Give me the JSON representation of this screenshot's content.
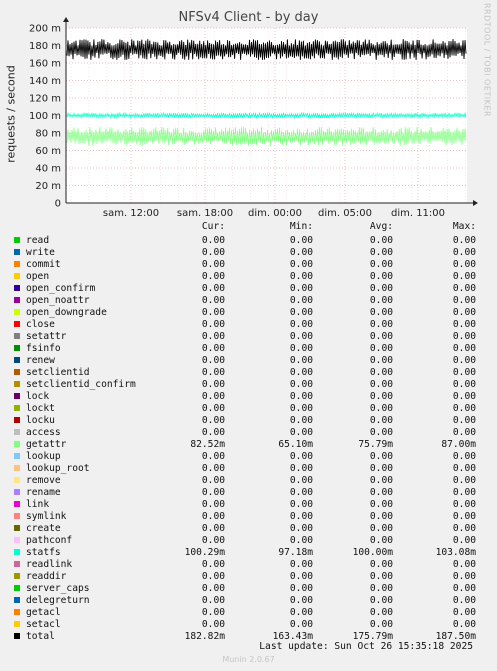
{
  "page": {
    "title": "NFSv4 Client - by day",
    "side_text": "RRDTOOL / TOBI OETIKER",
    "last_update": "Last update: Sun Oct 26 15:35:18 2025",
    "footer": "Munin 2.0.67"
  },
  "legend": {
    "headers": {
      "cur": "Cur:",
      "min": "Min:",
      "avg": "Avg:",
      "max": "Max:"
    },
    "rows": [
      {
        "name": "read",
        "color": "#00cc00",
        "cur": "0.00",
        "min": "0.00",
        "avg": "0.00",
        "max": "0.00"
      },
      {
        "name": "write",
        "color": "#0066b3",
        "cur": "0.00",
        "min": "0.00",
        "avg": "0.00",
        "max": "0.00"
      },
      {
        "name": "commit",
        "color": "#ff8000",
        "cur": "0.00",
        "min": "0.00",
        "avg": "0.00",
        "max": "0.00"
      },
      {
        "name": "open",
        "color": "#ffcc00",
        "cur": "0.00",
        "min": "0.00",
        "avg": "0.00",
        "max": "0.00"
      },
      {
        "name": "open_confirm",
        "color": "#330099",
        "cur": "0.00",
        "min": "0.00",
        "avg": "0.00",
        "max": "0.00"
      },
      {
        "name": "open_noattr",
        "color": "#990099",
        "cur": "0.00",
        "min": "0.00",
        "avg": "0.00",
        "max": "0.00"
      },
      {
        "name": "open_downgrade",
        "color": "#ccff00",
        "cur": "0.00",
        "min": "0.00",
        "avg": "0.00",
        "max": "0.00"
      },
      {
        "name": "close",
        "color": "#ff0000",
        "cur": "0.00",
        "min": "0.00",
        "avg": "0.00",
        "max": "0.00"
      },
      {
        "name": "setattr",
        "color": "#808080",
        "cur": "0.00",
        "min": "0.00",
        "avg": "0.00",
        "max": "0.00"
      },
      {
        "name": "fsinfo",
        "color": "#008f00",
        "cur": "0.00",
        "min": "0.00",
        "avg": "0.00",
        "max": "0.00"
      },
      {
        "name": "renew",
        "color": "#00487d",
        "cur": "0.00",
        "min": "0.00",
        "avg": "0.00",
        "max": "0.00"
      },
      {
        "name": "setclientid",
        "color": "#b35a00",
        "cur": "0.00",
        "min": "0.00",
        "avg": "0.00",
        "max": "0.00"
      },
      {
        "name": "setclientid_confirm",
        "color": "#b38f00",
        "cur": "0.00",
        "min": "0.00",
        "avg": "0.00",
        "max": "0.00"
      },
      {
        "name": "lock",
        "color": "#6b006b",
        "cur": "0.00",
        "min": "0.00",
        "avg": "0.00",
        "max": "0.00"
      },
      {
        "name": "lockt",
        "color": "#8fb300",
        "cur": "0.00",
        "min": "0.00",
        "avg": "0.00",
        "max": "0.00"
      },
      {
        "name": "locku",
        "color": "#b30000",
        "cur": "0.00",
        "min": "0.00",
        "avg": "0.00",
        "max": "0.00"
      },
      {
        "name": "access",
        "color": "#bebebe",
        "cur": "0.00",
        "min": "0.00",
        "avg": "0.00",
        "max": "0.00"
      },
      {
        "name": "getattr",
        "color": "#80ff80",
        "cur": "82.52m",
        "min": "65.10m",
        "avg": "75.79m",
        "max": "87.00m"
      },
      {
        "name": "lookup",
        "color": "#80c9ff",
        "cur": "0.00",
        "min": "0.00",
        "avg": "0.00",
        "max": "0.00"
      },
      {
        "name": "lookup_root",
        "color": "#ffc080",
        "cur": "0.00",
        "min": "0.00",
        "avg": "0.00",
        "max": "0.00"
      },
      {
        "name": "remove",
        "color": "#ffe680",
        "cur": "0.00",
        "min": "0.00",
        "avg": "0.00",
        "max": "0.00"
      },
      {
        "name": "rename",
        "color": "#aa80ff",
        "cur": "0.00",
        "min": "0.00",
        "avg": "0.00",
        "max": "0.00"
      },
      {
        "name": "link",
        "color": "#ee00cc",
        "cur": "0.00",
        "min": "0.00",
        "avg": "0.00",
        "max": "0.00"
      },
      {
        "name": "symlink",
        "color": "#ff8080",
        "cur": "0.00",
        "min": "0.00",
        "avg": "0.00",
        "max": "0.00"
      },
      {
        "name": "create",
        "color": "#666600",
        "cur": "0.00",
        "min": "0.00",
        "avg": "0.00",
        "max": "0.00"
      },
      {
        "name": "pathconf",
        "color": "#ffbfff",
        "cur": "0.00",
        "min": "0.00",
        "avg": "0.00",
        "max": "0.00"
      },
      {
        "name": "statfs",
        "color": "#00ffcc",
        "cur": "100.29m",
        "min": "97.18m",
        "avg": "100.00m",
        "max": "103.08m"
      },
      {
        "name": "readlink",
        "color": "#cc6699",
        "cur": "0.00",
        "min": "0.00",
        "avg": "0.00",
        "max": "0.00"
      },
      {
        "name": "readdir",
        "color": "#999900",
        "cur": "0.00",
        "min": "0.00",
        "avg": "0.00",
        "max": "0.00"
      },
      {
        "name": "server_caps",
        "color": "#00cc00",
        "cur": "0.00",
        "min": "0.00",
        "avg": "0.00",
        "max": "0.00"
      },
      {
        "name": "delegreturn",
        "color": "#0066b3",
        "cur": "0.00",
        "min": "0.00",
        "avg": "0.00",
        "max": "0.00"
      },
      {
        "name": "getacl",
        "color": "#ff8000",
        "cur": "0.00",
        "min": "0.00",
        "avg": "0.00",
        "max": "0.00"
      },
      {
        "name": "setacl",
        "color": "#ffcc00",
        "cur": "0.00",
        "min": "0.00",
        "avg": "0.00",
        "max": "0.00"
      },
      {
        "name": "total",
        "color": "#000000",
        "cur": "182.82m",
        "min": "163.43m",
        "avg": "175.79m",
        "max": "187.50m"
      }
    ]
  },
  "chart_data": {
    "type": "line",
    "title": "NFSv4 Client - by day",
    "ylabel": "requests / second",
    "xlabel": "",
    "ylim": [
      0,
      0.2
    ],
    "y_ticks": [
      {
        "value": 0,
        "label": "0"
      },
      {
        "value": 0.02,
        "label": "20 m"
      },
      {
        "value": 0.04,
        "label": "40 m"
      },
      {
        "value": 0.06,
        "label": "60 m"
      },
      {
        "value": 0.08,
        "label": "80 m"
      },
      {
        "value": 0.1,
        "label": "100 m"
      },
      {
        "value": 0.12,
        "label": "120 m"
      },
      {
        "value": 0.14,
        "label": "140 m"
      },
      {
        "value": 0.16,
        "label": "160 m"
      },
      {
        "value": 0.18,
        "label": "180 m"
      },
      {
        "value": 0.2,
        "label": "200 m"
      }
    ],
    "x_ticks": [
      "sam. 12:00",
      "sam. 18:00",
      "dim. 00:00",
      "dim. 05:00",
      "dim. 11:00"
    ],
    "grid": true,
    "series": [
      {
        "name": "total",
        "color": "#000000",
        "min": 0.16343,
        "avg": 0.17579,
        "max": 0.1875
      },
      {
        "name": "statfs",
        "color": "#00ffcc",
        "min": 0.09718,
        "avg": 0.1,
        "max": 0.10308
      },
      {
        "name": "getattr",
        "color": "#80ff80",
        "min": 0.0651,
        "avg": 0.07579,
        "max": 0.087
      }
    ]
  }
}
